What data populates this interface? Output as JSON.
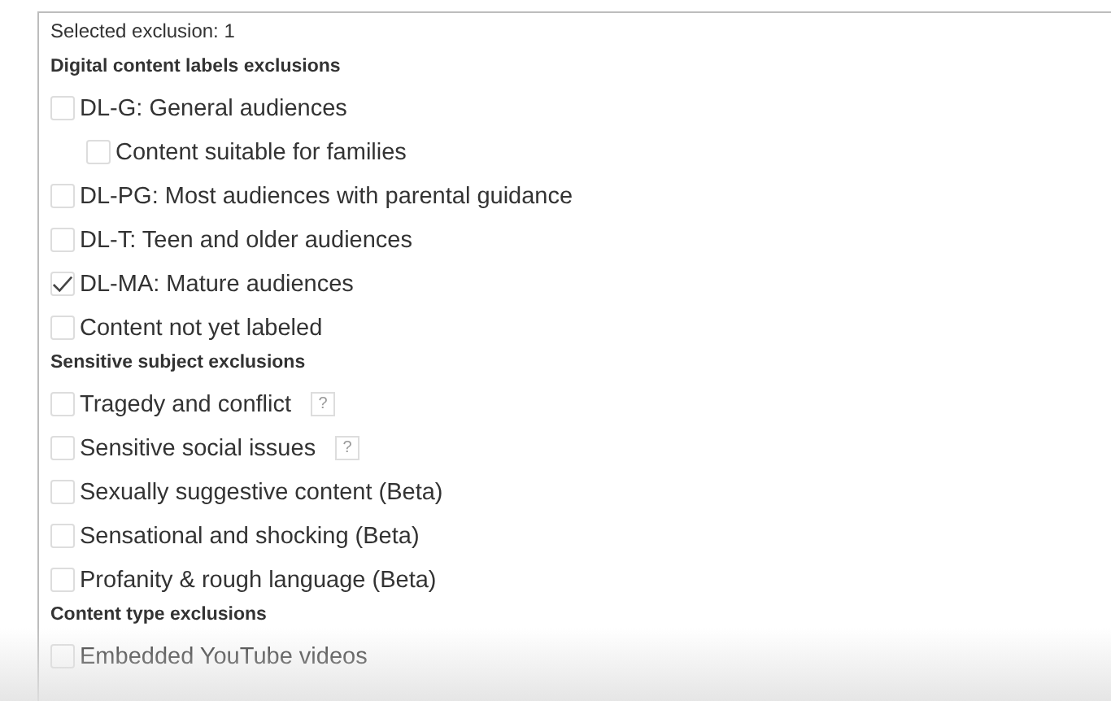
{
  "summary": "Selected exclusion: 1",
  "sections": [
    {
      "title": "Digital content labels exclusions",
      "items": [
        {
          "label": "DL-G: General audiences",
          "checked": false,
          "children": [
            {
              "label": "Content suitable for families",
              "checked": false
            }
          ]
        },
        {
          "label": "DL-PG: Most audiences with parental guidance",
          "checked": false
        },
        {
          "label": "DL-T: Teen and older audiences",
          "checked": false
        },
        {
          "label": "DL-MA: Mature audiences",
          "checked": true
        },
        {
          "label": "Content not yet labeled",
          "checked": false
        }
      ]
    },
    {
      "title": "Sensitive subject exclusions",
      "items": [
        {
          "label": "Tragedy and conflict",
          "checked": false,
          "help": "?"
        },
        {
          "label": "Sensitive social issues",
          "checked": false,
          "help": "?"
        },
        {
          "label": "Sexually suggestive content (Beta)",
          "checked": false
        },
        {
          "label": "Sensational and shocking (Beta)",
          "checked": false
        },
        {
          "label": "Profanity & rough language (Beta)",
          "checked": false
        }
      ]
    },
    {
      "title": "Content type exclusions",
      "items": [
        {
          "label": "Embedded YouTube videos",
          "checked": false
        }
      ]
    }
  ]
}
